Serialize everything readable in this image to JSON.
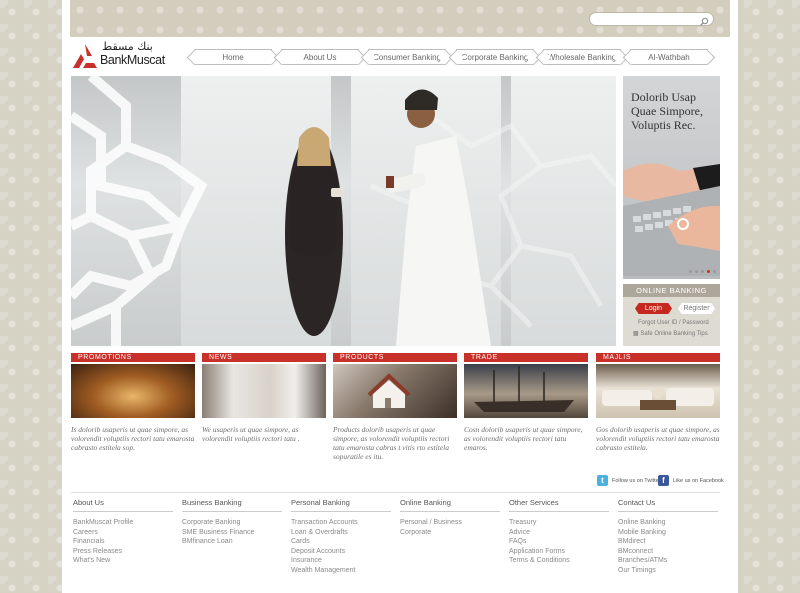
{
  "search": {
    "placeholder": ""
  },
  "brand": {
    "name": "BankMuscat",
    "arabic_name": "بنك مسقط"
  },
  "nav": [
    "Home",
    "About Us",
    "Consumer Banking",
    "Corporate Banking",
    "Wholesale Banking",
    "Al-Wathbah"
  ],
  "side_panel": {
    "title": "Dolorib Usap Quae Simpore, Voluptis Rec."
  },
  "online_banking": {
    "heading": "ONLINE BANKING",
    "login": "Login",
    "register": "Register",
    "forgot": "Forgot User ID / Password",
    "tips": "Safe Online Banking Tips"
  },
  "cards": [
    {
      "label": "PROMOTIONS",
      "text": "Is dolorib usaperis ut quae simpore, as volorendit voluptiis rectori tatu emarosta cabrasto estitela sop."
    },
    {
      "label": "NEWS",
      "text": "We usaperis ut quae simpore, as volorendit voluptiis rectori tatu ."
    },
    {
      "label": "PRODUCTS",
      "text": "Products dolorib usaperis ut quae simpore, as volorendit voluptiis rectori tatu emarosta cabras t vitis rto estitela sopuratile es itu."
    },
    {
      "label": "TRADE",
      "text": "Cosn  dolorib usaperis ut quae simpore, as volorendit voluptiis rectori tatu emaros."
    },
    {
      "label": "MAJLIS",
      "text": "Gos dolorib usaperis ut quae simpore, as volorendit voluptiis rectori tatu emarosta cabrasto estitela."
    }
  ],
  "social": {
    "twitter": "Follow us on Twitter",
    "facebook": "Like us on Facebook"
  },
  "footer": [
    {
      "heading": "About Us",
      "links": [
        "BankMuscat Profile",
        "Careers",
        "Financials",
        "Press Releases",
        "What's New"
      ]
    },
    {
      "heading": "Business Banking",
      "links": [
        "Corporate Banking",
        "SME Business Finance",
        "BMfinance Loan"
      ]
    },
    {
      "heading": "Personal Banking",
      "links": [
        "Transaction Accounts",
        "Loan & Overdrafts",
        "Cards",
        "Deposit Accounts",
        "Insurance",
        "Wealth Management"
      ]
    },
    {
      "heading": "Online Banking",
      "links": [
        "Personal / Business",
        "Corporate"
      ]
    },
    {
      "heading": "Other Services",
      "links": [
        "Treasury",
        "Advice",
        "FAQs",
        "Application Forms",
        "Terms & Conditions"
      ]
    },
    {
      "heading": "Contact Us",
      "links": [
        "Online Banking",
        "Mobile Banking",
        "BMdirect",
        "BMconnect",
        "Branches/ATMs",
        "Our Timings"
      ]
    }
  ],
  "colors": {
    "accent": "#c8302a",
    "background": "#d6d2c4",
    "panel_header": "#aca79a"
  }
}
